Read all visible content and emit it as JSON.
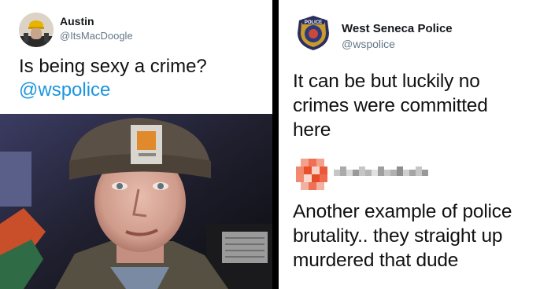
{
  "left_tweet": {
    "author_name": "Austin",
    "author_handle": "@ItsMacDoogle",
    "text_line1": "Is being sexy a crime?",
    "mention": "@wspolice",
    "avatar_icon": "avatar-hardhat-icon",
    "photo_description_icon": "selfie-photo"
  },
  "right_tweet": {
    "author_name": "West Seneca Police",
    "author_handle": "@wspolice",
    "badge_text_top": "POLICE",
    "text_line1": "It can be but luckily no",
    "text_line2": "crimes were committed",
    "text_line3": "here",
    "avatar_icon": "police-badge-icon"
  },
  "reply": {
    "avatar_icon": "pixelated-avatar-icon",
    "name_obscured": true,
    "text_line1": "Another example of police",
    "text_line2": "brutality.. they straight up",
    "text_line3": "murdered that dude"
  },
  "colors": {
    "mention": "#1b95e0",
    "handle": "#657786",
    "divider": "#000000"
  }
}
